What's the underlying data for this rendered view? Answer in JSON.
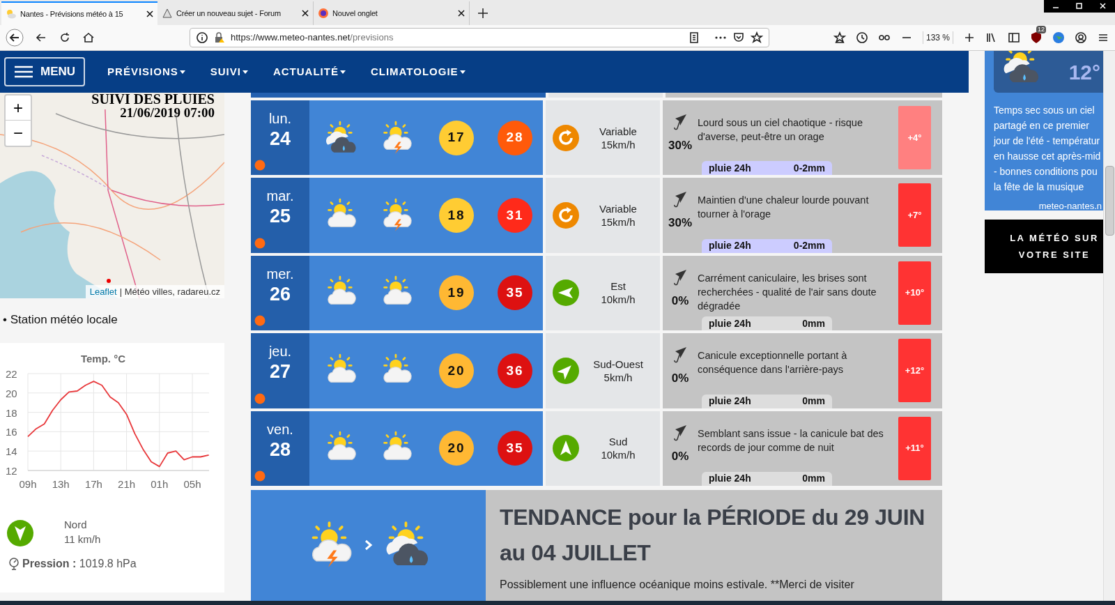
{
  "browser": {
    "tabs": [
      {
        "title": "Nantes - Prévisions météo à 15",
        "selected": true
      },
      {
        "title": "Créer un nouveau sujet - Forum",
        "selected": false
      },
      {
        "title": "Nouvel onglet",
        "selected": false
      }
    ],
    "url_host": "https://www.meteo-nantes.net",
    "url_path": "/previsions",
    "zoom": "133 %",
    "badge": "12"
  },
  "site_nav": {
    "menu": "MENU",
    "items": [
      "PRÉVISIONS",
      "SUIVI",
      "ACTUALITÉ",
      "CLIMATOLOGIE"
    ]
  },
  "map": {
    "title": "SUIVI DES PLUIES",
    "date": "21/06/2019 07:00",
    "zoom_in": "+",
    "zoom_out": "−",
    "attribution_link": "Leaflet",
    "attribution": "| Météo villes, radareu.cz"
  },
  "station": {
    "heading": "• Station météo locale",
    "chart_data": {
      "type": "line",
      "title": "Temp. °C",
      "categories": [
        "09h",
        null,
        null,
        null,
        "13h",
        null,
        null,
        null,
        "17h",
        null,
        null,
        null,
        "21h",
        null,
        null,
        null,
        "01h",
        null,
        null,
        null,
        "05h",
        null,
        null
      ],
      "series": [
        {
          "color": "#e8373a",
          "values": [
            15.5,
            16.3,
            16.8,
            18.2,
            19.3,
            20.1,
            20.2,
            20.8,
            21.2,
            20.8,
            19.6,
            19.0,
            17.8,
            15.8,
            14.2,
            12.9,
            12.4,
            13.8,
            14.0,
            13.1,
            13.4,
            13.4,
            13.6
          ]
        }
      ],
      "ylim": [
        12,
        22
      ],
      "yticks": [
        12,
        14,
        16,
        18,
        20,
        22
      ],
      "grid": true
    },
    "wind_direction": "Nord",
    "wind_speed": "11 km/h",
    "pressure": "**Pression :** 1019.8 hPa"
  },
  "forecast": [
    {
      "day": "lun.",
      "date": "24",
      "icons": [
        {
          "kind": "rain"
        },
        {
          "kind": "storm"
        }
      ],
      "min": {
        "value": "17",
        "color": "#ffcc33"
      },
      "max": {
        "value": "28",
        "color": "#ff5a0a"
      },
      "wind": {
        "kind": "variable",
        "direction": "Variable",
        "speed": "15km/h"
      },
      "rain_chance": "30%",
      "description": "Lourd sous un ciel chaotique - risque d'averse, peut-être un orage",
      "rain": {
        "label": "pluie 24h",
        "amount": "0-2mm",
        "color": "#ccccff"
      },
      "anomaly": {
        "value": "+4°",
        "color": "#ff8080"
      }
    },
    {
      "day": "mar.",
      "date": "25",
      "icons": [
        {
          "kind": "sun-cloud"
        },
        {
          "kind": "storm"
        }
      ],
      "min": {
        "value": "18",
        "color": "#ffcc33"
      },
      "max": {
        "value": "31",
        "color": "#ff2a1a"
      },
      "wind": {
        "kind": "variable",
        "direction": "Variable",
        "speed": "15km/h"
      },
      "rain_chance": "30%",
      "description": "Maintien d'une chaleur lourde pouvant tourner à l'orage",
      "rain": {
        "label": "pluie 24h",
        "amount": "0-2mm",
        "color": "#ccccff"
      },
      "anomaly": {
        "value": "+7°",
        "color": "#ff3333"
      }
    },
    {
      "day": "mer.",
      "date": "26",
      "icons": [
        {
          "kind": "sun-cloud"
        },
        {
          "kind": "sun-cloud"
        }
      ],
      "min": {
        "value": "19",
        "color": "#ffb833"
      },
      "max": {
        "value": "35",
        "color": "#dd1111"
      },
      "wind": {
        "kind": "east",
        "direction": "Est",
        "speed": "10km/h"
      },
      "rain_chance": "0%",
      "description": "Carrément caniculaire, les brises sont recherchées - qualité de l'air sans doute dégradée",
      "rain": {
        "label": "pluie 24h",
        "amount": "0mm",
        "color": "#dddddd"
      },
      "anomaly": {
        "value": "+10°",
        "color": "#ff3333"
      }
    },
    {
      "day": "jeu.",
      "date": "27",
      "icons": [
        {
          "kind": "sun-cloud"
        },
        {
          "kind": "sun-cloud"
        }
      ],
      "min": {
        "value": "20",
        "color": "#ffb833"
      },
      "max": {
        "value": "36",
        "color": "#dd1111"
      },
      "wind": {
        "kind": "southwest",
        "direction": "Sud-Ouest",
        "speed": "5km/h"
      },
      "rain_chance": "0%",
      "description": "Canicule exceptionnelle portant à conséquence dans l'arrière-pays",
      "rain": {
        "label": "pluie 24h",
        "amount": "0mm",
        "color": "#dddddd"
      },
      "anomaly": {
        "value": "+12°",
        "color": "#ff3333"
      }
    },
    {
      "day": "ven.",
      "date": "28",
      "icons": [
        {
          "kind": "sun-cloud"
        },
        {
          "kind": "sun-cloud"
        }
      ],
      "min": {
        "value": "20",
        "color": "#ffb833"
      },
      "max": {
        "value": "35",
        "color": "#dd1111"
      },
      "wind": {
        "kind": "south",
        "direction": "Sud",
        "speed": "10km/h"
      },
      "rain_chance": "0%",
      "description": "Semblant sans issue - la canicule bat des records de jour comme de nuit",
      "rain": {
        "label": "pluie 24h",
        "amount": "0mm",
        "color": "#dddddd"
      },
      "anomaly": {
        "value": "+11°",
        "color": "#ff3333"
      }
    }
  ],
  "trend": {
    "icons": [
      {
        "kind": "storm"
      },
      {
        "kind": "rain"
      }
    ],
    "title": "TENDANCE pour la PÉRIODE du 29 JUIN au 04 JUILLET",
    "text": "Possiblement une influence océanique moins estivale. **Merci de visiter"
  },
  "sidebar": {
    "temperature": "12°",
    "text_lines": [
      "Temps sec sous un ciel",
      "partagé en ce premier",
      "jour de l'été - températur",
      "en hausse cet après-mid",
      "- bonnes conditions pou",
      "la fête de la musique"
    ],
    "site": "meteo-nantes.n",
    "banner": [
      "LA MÉTÉO SUR",
      "VOTRE SITE"
    ]
  }
}
